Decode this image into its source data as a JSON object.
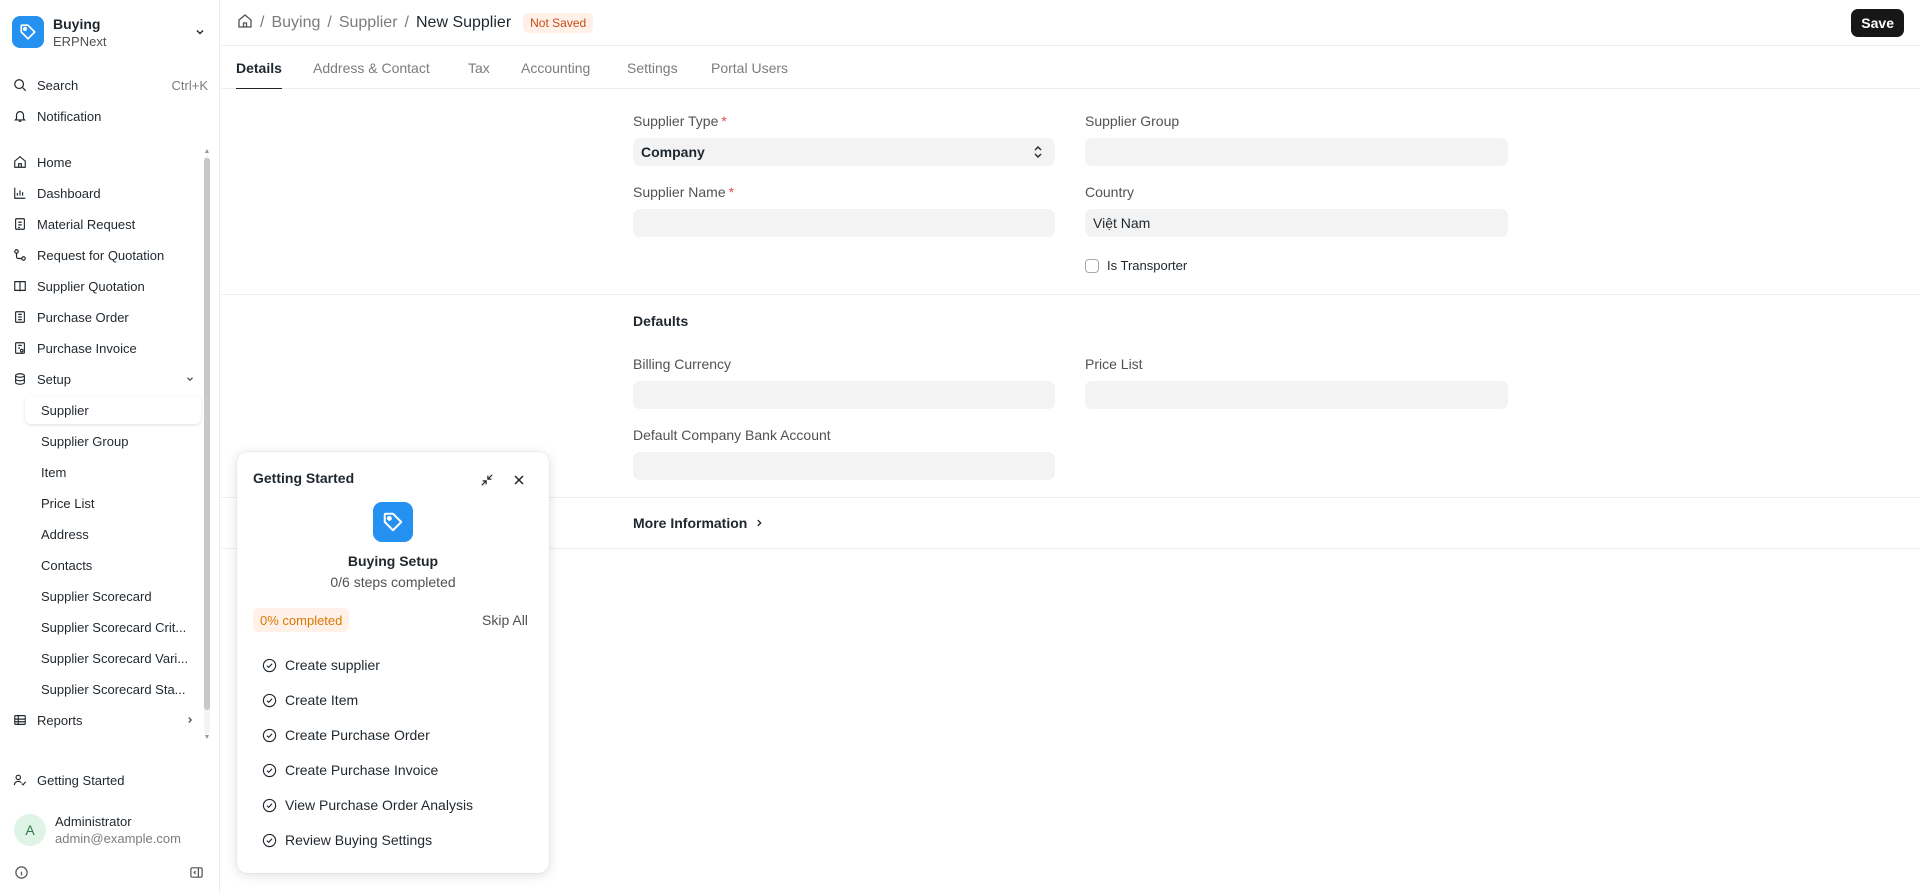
{
  "app": {
    "title": "Buying",
    "subtitle": "ERPNext"
  },
  "quick": {
    "search_label": "Search",
    "search_shortcut": "Ctrl+K",
    "notification_label": "Notification"
  },
  "nav": {
    "items": [
      {
        "label": "Home",
        "icon": "home-icon"
      },
      {
        "label": "Dashboard",
        "icon": "chart-icon"
      },
      {
        "label": "Material Request",
        "icon": "clipboard-icon"
      },
      {
        "label": "Request for Quotation",
        "icon": "workflow-icon"
      },
      {
        "label": "Supplier Quotation",
        "icon": "book-icon"
      },
      {
        "label": "Purchase Order",
        "icon": "file-icon"
      },
      {
        "label": "Purchase Invoice",
        "icon": "invoice-icon"
      },
      {
        "label": "Setup",
        "icon": "database-icon"
      }
    ],
    "setup_children": [
      "Supplier",
      "Supplier Group",
      "Item",
      "Price List",
      "Address",
      "Contacts",
      "Supplier Scorecard",
      "Supplier Scorecard Crit...",
      "Supplier Scorecard Vari...",
      "Supplier Scorecard Sta..."
    ],
    "reports_label": "Reports"
  },
  "footer": {
    "getting_started_label": "Getting Started",
    "user_initial": "A",
    "user_name": "Administrator",
    "user_email": "admin@example.com"
  },
  "header": {
    "breadcrumbs": [
      "Buying",
      "Supplier",
      "New Supplier"
    ],
    "status_badge": "Not Saved",
    "save_label": "Save"
  },
  "tabs": [
    "Details",
    "Address & Contact",
    "Tax",
    "Accounting",
    "Settings",
    "Portal Users"
  ],
  "form": {
    "supplier_type_label": "Supplier Type",
    "supplier_type_value": "Company",
    "supplier_group_label": "Supplier Group",
    "supplier_group_value": "",
    "supplier_name_label": "Supplier Name",
    "supplier_name_value": "",
    "country_label": "Country",
    "country_value": "Việt Nam",
    "is_transporter_label": "Is Transporter",
    "defaults_title": "Defaults",
    "billing_currency_label": "Billing Currency",
    "billing_currency_value": "",
    "price_list_label": "Price List",
    "price_list_value": "",
    "bank_account_label": "Default Company Bank Account",
    "bank_account_value": "",
    "more_info_label": "More Information",
    "required_mark": "*"
  },
  "getting_started": {
    "title": "Getting Started",
    "module_name": "Buying Setup",
    "steps_summary": "0/6 steps completed",
    "progress_label": "0% completed",
    "skip_label": "Skip All",
    "steps": [
      "Create supplier",
      "Create Item",
      "Create Purchase Order",
      "Create Purchase Invoice",
      "View Purchase Order Analysis",
      "Review Buying Settings"
    ]
  },
  "colors": {
    "brand": "#2490ef",
    "text": "#1f272e",
    "muted": "#7c7c7c",
    "badge_bg": "#fff1e7",
    "badge_text": "#cb4a1a",
    "save_bg": "#171717",
    "required": "#e24c4c"
  }
}
